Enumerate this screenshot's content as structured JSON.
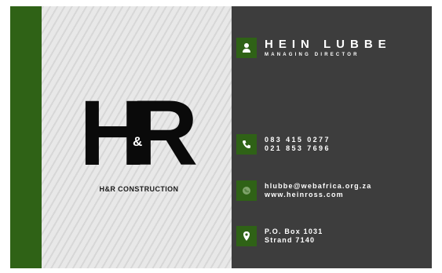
{
  "logo": {
    "letter_left": "H",
    "ampersand": "&",
    "letter_right": "R",
    "company": "H&R CONSTRUCTION"
  },
  "person": {
    "name": "HEIN LUBBE",
    "title": "MANAGING DIRECTOR"
  },
  "contact": {
    "phones": [
      "083 415 0277",
      "021 853 7696"
    ],
    "email": "hlubbe@webafrica.org.za",
    "website": "www.heinross.com",
    "address": [
      "P.O. Box 1031",
      "Strand 7140"
    ]
  },
  "icons": {
    "person": "person-icon",
    "phone": "phone-icon",
    "web": "globe-icon",
    "location": "map-pin-icon"
  },
  "colors": {
    "accent_green": "#2f6216",
    "dark_panel": "#3d3d3d",
    "logo_black": "#0a0a0a"
  }
}
